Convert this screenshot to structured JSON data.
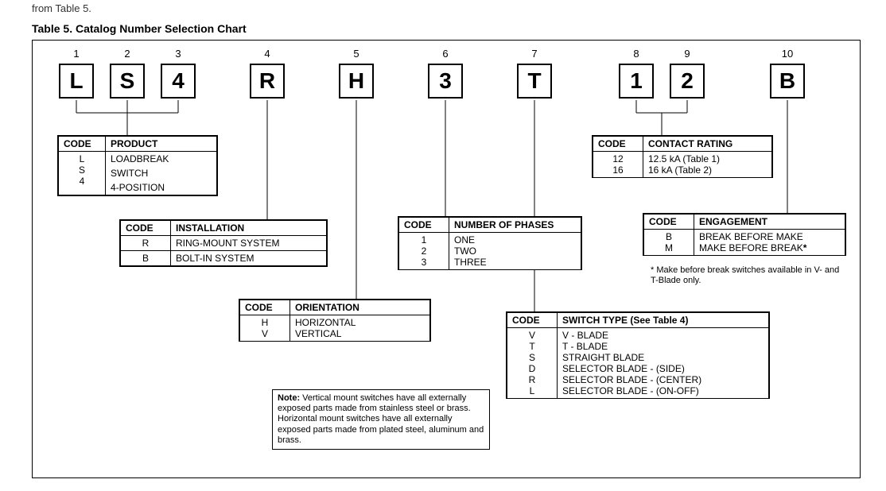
{
  "pretext": "from Table 5.",
  "title": "Table 5. Catalog Number Selection Chart",
  "positions": {
    "1": "1",
    "2": "2",
    "3": "3",
    "4": "4",
    "5": "5",
    "6": "6",
    "7": "7",
    "8": "8",
    "9": "9",
    "10": "10"
  },
  "codes": {
    "c1": "L",
    "c2": "S",
    "c3": "4",
    "c4": "R",
    "c5": "H",
    "c6": "3",
    "c7": "T",
    "c8": "1",
    "c9": "2",
    "c10": "B"
  },
  "product": {
    "h_code": "CODE",
    "h_desc": "PRODUCT",
    "r1_code": "L",
    "r1_desc": "LOADBREAK",
    "r2_code": "S",
    "r2_desc": "SWITCH",
    "r3_code": "4",
    "r3_desc": "4-POSITION"
  },
  "installation": {
    "h_code": "CODE",
    "h_desc": "INSTALLATION",
    "r1_code": "R",
    "r1_desc": "RING-MOUNT SYSTEM",
    "r2_code": "B",
    "r2_desc": "BOLT-IN SYSTEM"
  },
  "orientation": {
    "h_code": "CODE",
    "h_desc": "ORIENTATION",
    "r1_code": "H",
    "r1_desc": "HORIZONTAL",
    "r2_code": "V",
    "r2_desc": "VERTICAL"
  },
  "phases": {
    "h_code": "CODE",
    "h_desc": "NUMBER OF PHASES",
    "r1_code": "1",
    "r1_desc": "ONE",
    "r2_code": "2",
    "r2_desc": "TWO",
    "r3_code": "3",
    "r3_desc": "THREE"
  },
  "contact_rating": {
    "h_code": "CODE",
    "h_desc": "CONTACT RATING",
    "r1_code": "12",
    "r1_desc": "12.5 kA (Table 1)",
    "r2_code": "16",
    "r2_desc": "16 kA (Table 2)"
  },
  "engagement": {
    "h_code": "CODE",
    "h_desc": "ENGAGEMENT",
    "r1_code": "B",
    "r1_desc": "BREAK BEFORE MAKE",
    "r2_code": "M",
    "r2_desc": "MAKE BEFORE BREAK",
    "ast": "*"
  },
  "engagement_footnote": "*  Make before break switches available in V- and T-Blade only.",
  "switch_type": {
    "h_code": "CODE",
    "h_desc": "SWITCH TYPE (See Table 4)",
    "r1_code": "V",
    "r1_desc": "V - BLADE",
    "r2_code": "T",
    "r2_desc": "T - BLADE",
    "r3_code": "S",
    "r3_desc": "STRAIGHT BLADE",
    "r4_code": "D",
    "r4_desc": "SELECTOR BLADE - (SIDE)",
    "r5_code": "R",
    "r5_desc": "SELECTOR BLADE - (CENTER)",
    "r6_code": "L",
    "r6_desc": "SELECTOR BLADE - (ON-OFF)"
  },
  "note_label": "Note:",
  "note_text": " Vertical mount switches have all externally exposed parts made from stainless steel or brass. Horizontal mount switches have all externally exposed parts made from plated steel, aluminum and brass."
}
